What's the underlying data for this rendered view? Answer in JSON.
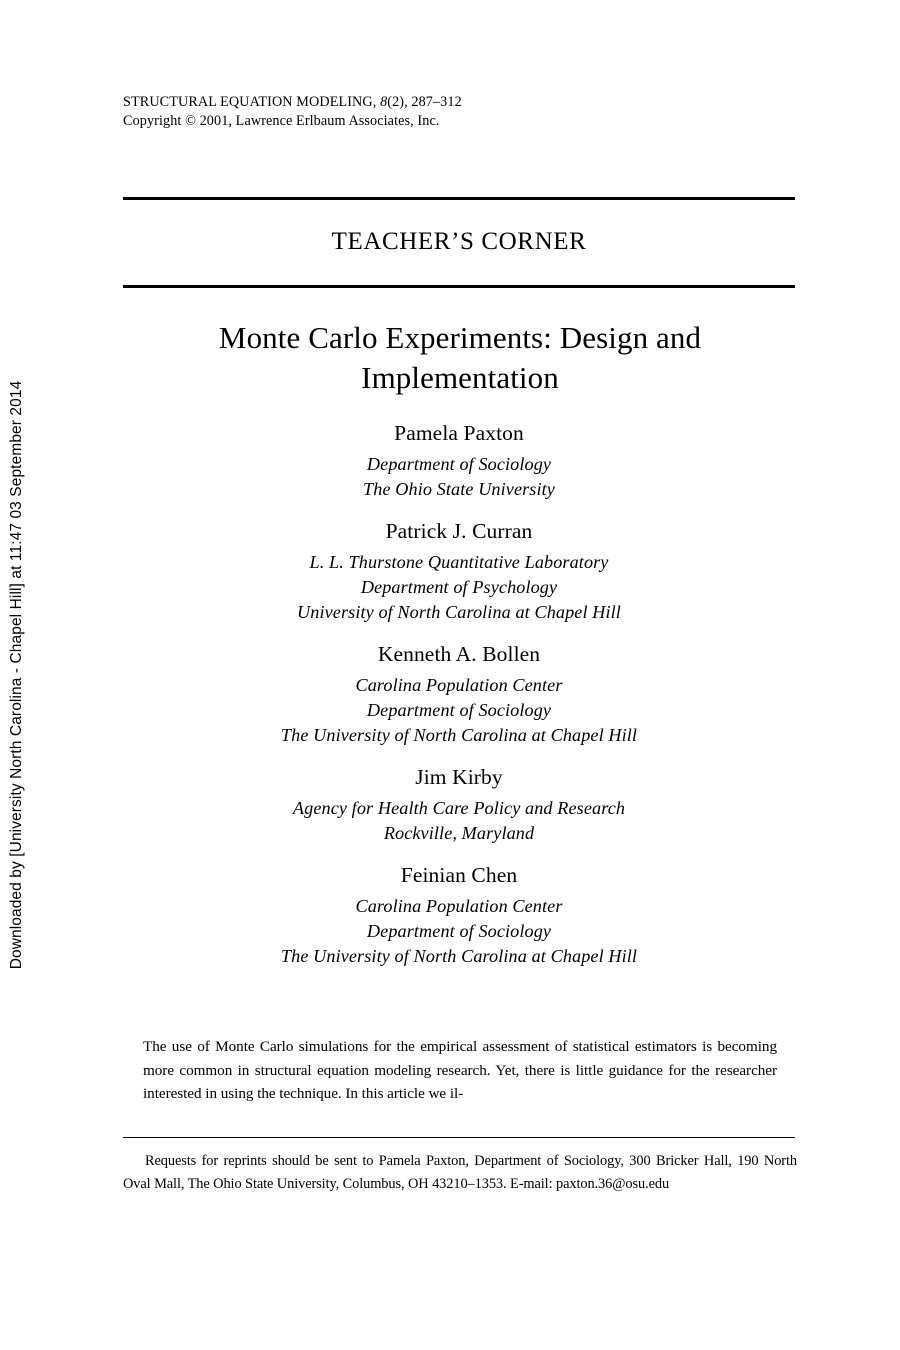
{
  "stamp": {
    "text": "Downloaded by [University North Carolina - Chapel Hill] at 11:47 03 September 2014"
  },
  "journal_header": {
    "title": "STRUCTURAL EQUATION MODELING,",
    "volume": "8",
    "issue_pages": "(2), 287–312",
    "copyright": "Copyright © 2001, Lawrence Erlbaum Associates, Inc."
  },
  "section": {
    "banner": "TEACHER’S CORNER"
  },
  "article": {
    "title_line1": "Monte Carlo Experiments: Design and",
    "title_line2": "Implementation"
  },
  "authors": [
    {
      "name": "Pamela Paxton",
      "affiliation": [
        "Department of Sociology",
        "The Ohio State University"
      ]
    },
    {
      "name": "Patrick J. Curran",
      "affiliation": [
        "L. L. Thurstone Quantitative Laboratory",
        "Department of Psychology",
        "University of North Carolina at Chapel Hill"
      ]
    },
    {
      "name": "Kenneth A. Bollen",
      "affiliation": [
        "Carolina Population Center",
        "Department of Sociology",
        "The University of North Carolina at Chapel Hill"
      ]
    },
    {
      "name": "Jim Kirby",
      "affiliation": [
        "Agency for Health Care Policy and Research",
        "Rockville, Maryland"
      ]
    },
    {
      "name": "Feinian Chen",
      "affiliation": [
        "Carolina Population Center",
        "Department of Sociology",
        "The University of North Carolina at Chapel Hill"
      ]
    }
  ],
  "abstract": {
    "text": "The use of Monte Carlo simulations for the empirical assessment of statistical estimators is becoming more common in structural equation modeling research. Yet, there is little guidance for the researcher interested in using the technique. In this article we il-"
  },
  "footnote": {
    "text": "Requests for reprints should be sent to Pamela Paxton, Department of Sociology, 300 Bricker Hall, 190 North Oval Mall, The Ohio State University, Columbus, OH  43210–1353. E-mail: paxton.36@osu.edu"
  }
}
